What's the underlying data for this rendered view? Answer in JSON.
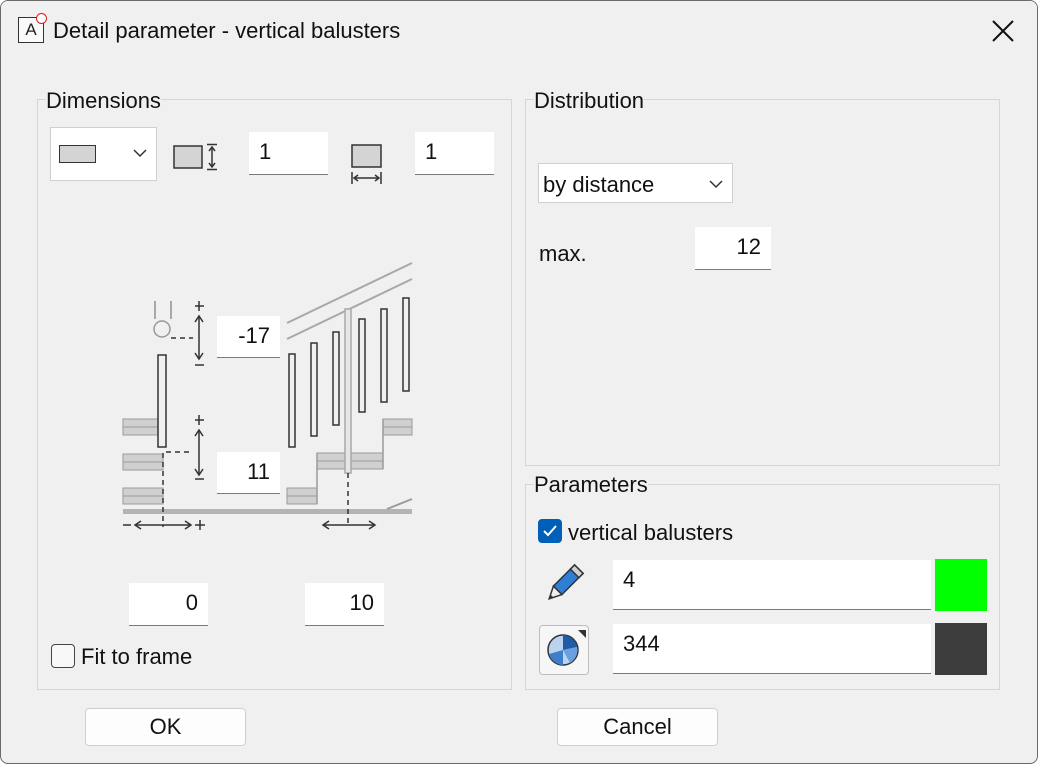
{
  "window": {
    "title": "Detail parameter - vertical balusters"
  },
  "dimensions": {
    "label": "Dimensions",
    "height_value": "1",
    "width_value": "1",
    "top_offset": "-17",
    "bottom_offset": "11",
    "left_offset": "0",
    "spacing_offset": "10",
    "fit_to_frame_label": "Fit to frame",
    "fit_to_frame_checked": false,
    "plus": "+",
    "minus": "−"
  },
  "distribution": {
    "label": "Distribution",
    "mode": "by distance",
    "max_label": "max.",
    "max_value": "12"
  },
  "parameters": {
    "label": "Parameters",
    "checkbox_label": "vertical balusters",
    "checkbox_checked": true,
    "pen_value": "4",
    "pen_color": "#00ff00",
    "line_value": "344",
    "line_color": "#3c3c3c"
  },
  "buttons": {
    "ok": "OK",
    "cancel": "Cancel"
  }
}
